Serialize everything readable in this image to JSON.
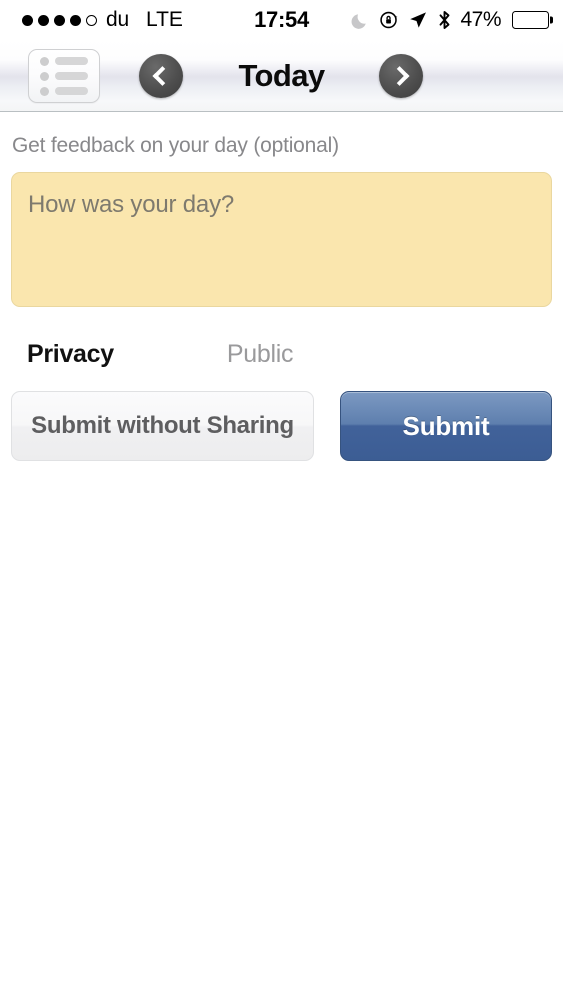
{
  "status_bar": {
    "signal_dots_filled": 4,
    "signal_dots_total": 5,
    "carrier": "du",
    "network": "LTE",
    "time": "17:54",
    "battery_percent": "47%",
    "battery_level": 47,
    "icons": [
      "moon-do-not-disturb-icon",
      "rotation-lock-icon",
      "location-arrow-icon",
      "bluetooth-icon"
    ]
  },
  "nav_bar": {
    "list_button_label": "list-menu",
    "prev_button_label": "previous-day",
    "next_button_label": "next-day",
    "title": "Today"
  },
  "main": {
    "feedback_label": "Get feedback on your day (optional)",
    "feedback_placeholder": "How was your day?",
    "feedback_value": "",
    "privacy_label": "Privacy",
    "privacy_value": "Public",
    "submit_without_sharing_label": "Submit without Sharing",
    "submit_label": "Submit"
  },
  "colors": {
    "feedback_background": "#fae6ae",
    "feedback_border": "#ead79f",
    "primary_button_top": "#7c99c2",
    "primary_button_bottom": "#3c5d94",
    "secondary_button_text": "#5e5e60",
    "label_gray": "#88888b",
    "nav_circle": "#4e4e4e"
  }
}
